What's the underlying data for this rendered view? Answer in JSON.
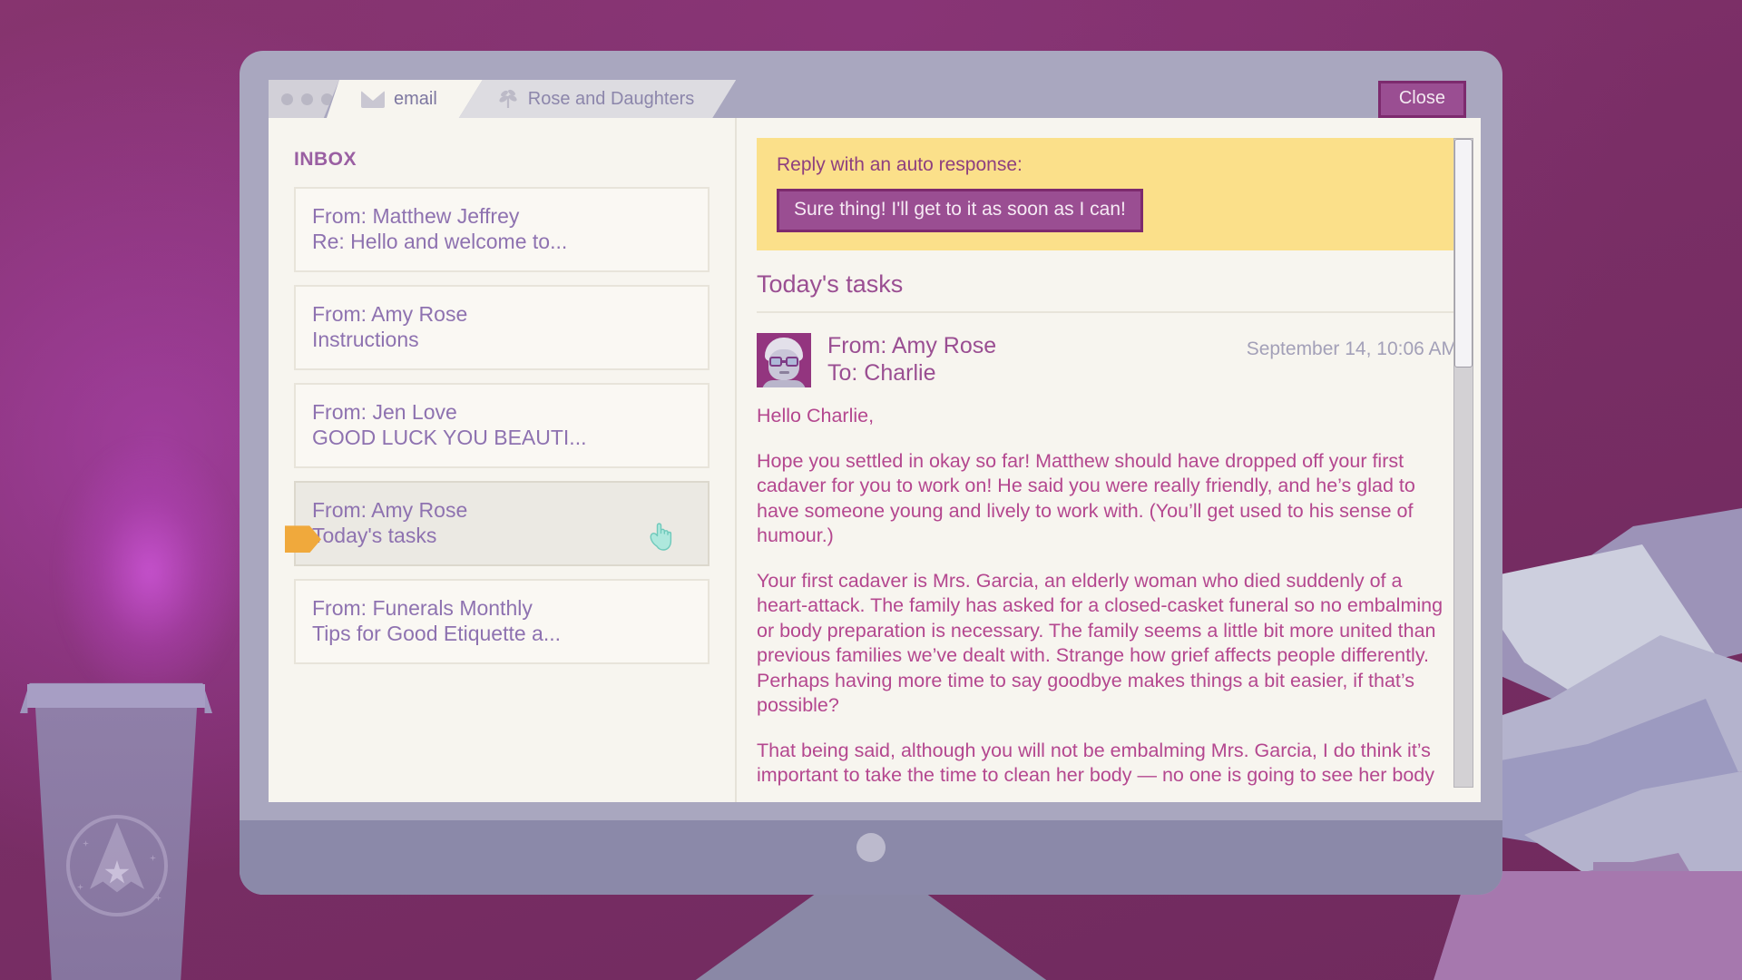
{
  "window": {
    "tabs": [
      {
        "label": "email",
        "icon": "envelope-icon",
        "active": true
      },
      {
        "label": "Rose and Daughters",
        "icon": "leaf-branch-icon",
        "active": false
      }
    ],
    "close_label": "Close"
  },
  "inbox": {
    "title": "INBOX",
    "items": [
      {
        "from": "From: Matthew Jeffrey",
        "subject": "Re: Hello and welcome to...",
        "selected": false,
        "flagged": false
      },
      {
        "from": "From: Amy Rose",
        "subject": "Instructions",
        "selected": false,
        "flagged": false
      },
      {
        "from": "From: Jen Love",
        "subject": "GOOD LUCK YOU BEAUTI...",
        "selected": false,
        "flagged": false
      },
      {
        "from": "From: Amy Rose",
        "subject": "Today's tasks",
        "selected": true,
        "flagged": true
      },
      {
        "from": "From: Funerals Monthly",
        "subject": "Tips for Good Etiquette a...",
        "selected": false,
        "flagged": false
      }
    ]
  },
  "reading": {
    "auto_reply_label": "Reply with an auto response:",
    "auto_reply_button": "Sure thing! I'll get to it as soon as I can!",
    "thread_title": "Today's tasks",
    "message": {
      "from": "From: Amy Rose",
      "to": "To: Charlie",
      "date": "September 14, 10:06 AM",
      "avatar": "amy-rose-avatar",
      "paragraphs": [
        "Hello Charlie,",
        "Hope you settled in okay so far! Matthew should have dropped off your first cadaver for you to work on! He said you were really friendly, and he’s glad to have someone young and lively to work with. (You’ll get used to his sense of humour.)",
        "Your first cadaver is Mrs. Garcia, an elderly woman who died suddenly of a heart-attack. The family has asked for a closed-casket funeral so no embalming or body preparation is necessary. The family seems a little bit more united than previous families we’ve dealt with. Strange how grief affects people differently. Perhaps having more time to say goodbye makes things a bit easier, if that’s possible?",
        "That being said, although you will not be embalming Mrs. Garcia, I do think it’s important to take the time to clean her body — no one is going to see her body"
      ]
    }
  },
  "colors": {
    "accent_purple": "#9a4e92",
    "body_pink": "#b4478f",
    "highlight_yellow": "#fbe08a",
    "flag_orange": "#f0a93c",
    "cursor_mint": "#a8e6dc",
    "desktop_magenta": "#7c2f6b"
  }
}
